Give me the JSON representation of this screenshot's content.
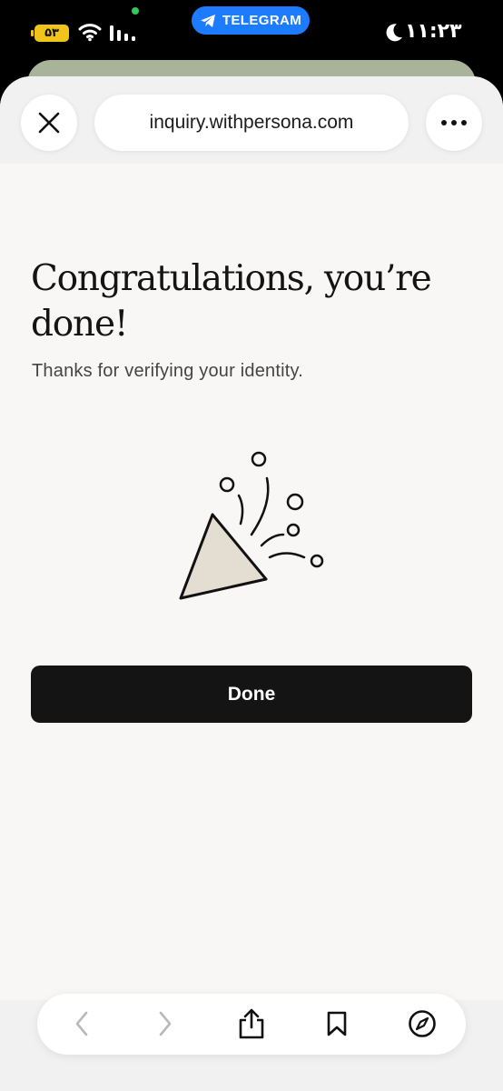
{
  "status_bar": {
    "time": "۱۱:۲۳",
    "battery_label": "۵۳",
    "app_pill_label": "TELEGRAM",
    "icons": [
      "battery-icon",
      "wifi-icon",
      "signal-icon",
      "telegram-icon",
      "moon-icon"
    ]
  },
  "browser": {
    "url": "inquiry.withpersona.com",
    "close_icon": "close-icon",
    "more_icon": "more-icon"
  },
  "page": {
    "heading": "Congratulations, you’re done!",
    "subtitle": "Thanks for verifying your identity.",
    "illustration_icon": "party-popper-icon",
    "done_label": "Done"
  },
  "toolbar": {
    "icons": [
      "back-icon",
      "forward-icon",
      "share-icon",
      "bookmarks-icon",
      "compass-icon"
    ]
  },
  "colors": {
    "background": "#f8f7f5",
    "button": "#141414",
    "telegram": "#1d7bff",
    "battery": "#f0c419",
    "popper_fill": "#e3ddd2"
  }
}
